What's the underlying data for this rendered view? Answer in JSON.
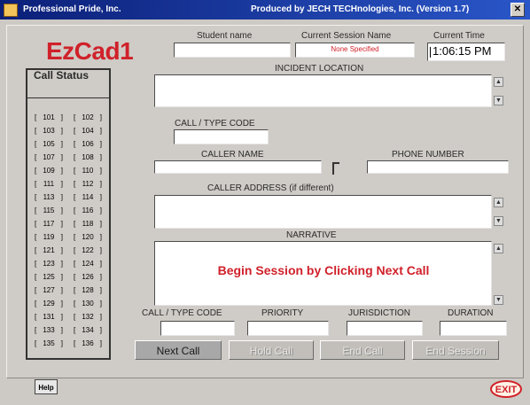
{
  "window": {
    "title_left": "Professional Pride, Inc.",
    "title_right": "Produced by JECH TECHnologies, Inc. (Version 1.7)",
    "close_glyph": "✕"
  },
  "brand": "EzCad1",
  "header": {
    "student_name_label": "Student name",
    "student_name_value": "",
    "session_label": "Current Session Name",
    "session_value": "None Specified",
    "time_label": "Current Time",
    "time_value": "1:06:15 PM"
  },
  "call_status": {
    "title": "Call Status",
    "units": [
      [
        "101",
        "102"
      ],
      [
        "103",
        "104"
      ],
      [
        "105",
        "106"
      ],
      [
        "107",
        "108"
      ],
      [
        "109",
        "110"
      ],
      [
        "111",
        "112"
      ],
      [
        "113",
        "114"
      ],
      [
        "115",
        "116"
      ],
      [
        "117",
        "118"
      ],
      [
        "119",
        "120"
      ],
      [
        "121",
        "122"
      ],
      [
        "123",
        "124"
      ],
      [
        "125",
        "126"
      ],
      [
        "127",
        "128"
      ],
      [
        "129",
        "130"
      ],
      [
        "131",
        "132"
      ],
      [
        "133",
        "134"
      ],
      [
        "135",
        "136"
      ]
    ]
  },
  "form": {
    "incident_location_label": "INCIDENT LOCATION",
    "call_type_label": "CALL / TYPE CODE",
    "caller_name_label": "CALLER NAME",
    "phone_label": "PHONE NUMBER",
    "caller_address_label": "CALLER ADDRESS (if different)",
    "narrative_label": "NARRATIVE",
    "narrative_message": "Begin Session by Clicking Next Call",
    "call_type_code2_label": "CALL / TYPE CODE",
    "priority_label": "PRIORITY",
    "jurisdiction_label": "JURISDICTION",
    "duration_label": "DURATION"
  },
  "buttons": {
    "next_call": "Next Call",
    "hold_call": "Hold Call",
    "end_call": "End Call",
    "end_session": "End Session"
  },
  "footer": {
    "help": "Help",
    "exit": "EXIT"
  },
  "icons": {
    "scroll_up": "▲",
    "scroll_down": "▼"
  }
}
